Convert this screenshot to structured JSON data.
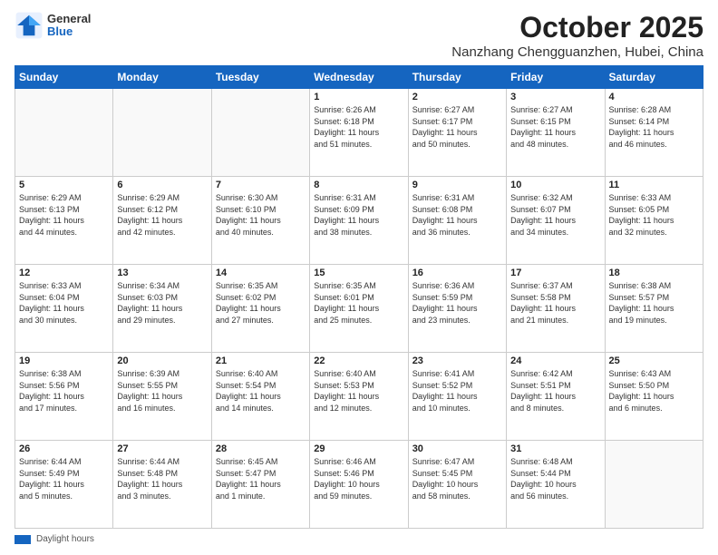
{
  "header": {
    "logo_general": "General",
    "logo_blue": "Blue",
    "title": "October 2025",
    "subtitle": "Nanzhang Chengguanzhen, Hubei, China"
  },
  "days_of_week": [
    "Sunday",
    "Monday",
    "Tuesday",
    "Wednesday",
    "Thursday",
    "Friday",
    "Saturday"
  ],
  "legend_label": "Daylight hours",
  "weeks": [
    [
      {
        "day": "",
        "info": ""
      },
      {
        "day": "",
        "info": ""
      },
      {
        "day": "",
        "info": ""
      },
      {
        "day": "1",
        "info": "Sunrise: 6:26 AM\nSunset: 6:18 PM\nDaylight: 11 hours\nand 51 minutes."
      },
      {
        "day": "2",
        "info": "Sunrise: 6:27 AM\nSunset: 6:17 PM\nDaylight: 11 hours\nand 50 minutes."
      },
      {
        "day": "3",
        "info": "Sunrise: 6:27 AM\nSunset: 6:15 PM\nDaylight: 11 hours\nand 48 minutes."
      },
      {
        "day": "4",
        "info": "Sunrise: 6:28 AM\nSunset: 6:14 PM\nDaylight: 11 hours\nand 46 minutes."
      }
    ],
    [
      {
        "day": "5",
        "info": "Sunrise: 6:29 AM\nSunset: 6:13 PM\nDaylight: 11 hours\nand 44 minutes."
      },
      {
        "day": "6",
        "info": "Sunrise: 6:29 AM\nSunset: 6:12 PM\nDaylight: 11 hours\nand 42 minutes."
      },
      {
        "day": "7",
        "info": "Sunrise: 6:30 AM\nSunset: 6:10 PM\nDaylight: 11 hours\nand 40 minutes."
      },
      {
        "day": "8",
        "info": "Sunrise: 6:31 AM\nSunset: 6:09 PM\nDaylight: 11 hours\nand 38 minutes."
      },
      {
        "day": "9",
        "info": "Sunrise: 6:31 AM\nSunset: 6:08 PM\nDaylight: 11 hours\nand 36 minutes."
      },
      {
        "day": "10",
        "info": "Sunrise: 6:32 AM\nSunset: 6:07 PM\nDaylight: 11 hours\nand 34 minutes."
      },
      {
        "day": "11",
        "info": "Sunrise: 6:33 AM\nSunset: 6:05 PM\nDaylight: 11 hours\nand 32 minutes."
      }
    ],
    [
      {
        "day": "12",
        "info": "Sunrise: 6:33 AM\nSunset: 6:04 PM\nDaylight: 11 hours\nand 30 minutes."
      },
      {
        "day": "13",
        "info": "Sunrise: 6:34 AM\nSunset: 6:03 PM\nDaylight: 11 hours\nand 29 minutes."
      },
      {
        "day": "14",
        "info": "Sunrise: 6:35 AM\nSunset: 6:02 PM\nDaylight: 11 hours\nand 27 minutes."
      },
      {
        "day": "15",
        "info": "Sunrise: 6:35 AM\nSunset: 6:01 PM\nDaylight: 11 hours\nand 25 minutes."
      },
      {
        "day": "16",
        "info": "Sunrise: 6:36 AM\nSunset: 5:59 PM\nDaylight: 11 hours\nand 23 minutes."
      },
      {
        "day": "17",
        "info": "Sunrise: 6:37 AM\nSunset: 5:58 PM\nDaylight: 11 hours\nand 21 minutes."
      },
      {
        "day": "18",
        "info": "Sunrise: 6:38 AM\nSunset: 5:57 PM\nDaylight: 11 hours\nand 19 minutes."
      }
    ],
    [
      {
        "day": "19",
        "info": "Sunrise: 6:38 AM\nSunset: 5:56 PM\nDaylight: 11 hours\nand 17 minutes."
      },
      {
        "day": "20",
        "info": "Sunrise: 6:39 AM\nSunset: 5:55 PM\nDaylight: 11 hours\nand 16 minutes."
      },
      {
        "day": "21",
        "info": "Sunrise: 6:40 AM\nSunset: 5:54 PM\nDaylight: 11 hours\nand 14 minutes."
      },
      {
        "day": "22",
        "info": "Sunrise: 6:40 AM\nSunset: 5:53 PM\nDaylight: 11 hours\nand 12 minutes."
      },
      {
        "day": "23",
        "info": "Sunrise: 6:41 AM\nSunset: 5:52 PM\nDaylight: 11 hours\nand 10 minutes."
      },
      {
        "day": "24",
        "info": "Sunrise: 6:42 AM\nSunset: 5:51 PM\nDaylight: 11 hours\nand 8 minutes."
      },
      {
        "day": "25",
        "info": "Sunrise: 6:43 AM\nSunset: 5:50 PM\nDaylight: 11 hours\nand 6 minutes."
      }
    ],
    [
      {
        "day": "26",
        "info": "Sunrise: 6:44 AM\nSunset: 5:49 PM\nDaylight: 11 hours\nand 5 minutes."
      },
      {
        "day": "27",
        "info": "Sunrise: 6:44 AM\nSunset: 5:48 PM\nDaylight: 11 hours\nand 3 minutes."
      },
      {
        "day": "28",
        "info": "Sunrise: 6:45 AM\nSunset: 5:47 PM\nDaylight: 11 hours\nand 1 minute."
      },
      {
        "day": "29",
        "info": "Sunrise: 6:46 AM\nSunset: 5:46 PM\nDaylight: 10 hours\nand 59 minutes."
      },
      {
        "day": "30",
        "info": "Sunrise: 6:47 AM\nSunset: 5:45 PM\nDaylight: 10 hours\nand 58 minutes."
      },
      {
        "day": "31",
        "info": "Sunrise: 6:48 AM\nSunset: 5:44 PM\nDaylight: 10 hours\nand 56 minutes."
      },
      {
        "day": "",
        "info": ""
      }
    ]
  ]
}
